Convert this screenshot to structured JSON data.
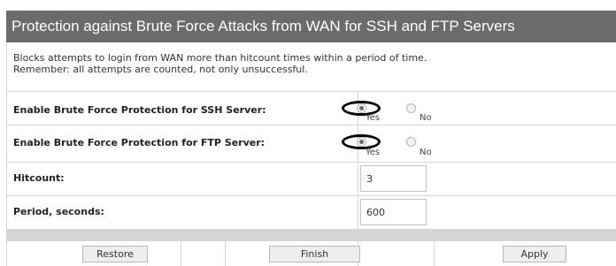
{
  "header": {
    "title": "Protection against Brute Force Attacks from WAN for SSH and FTP Servers"
  },
  "description": {
    "line1": "Blocks attempts to login from WAN more than hitcount times within a period of time.",
    "line2": "Remember: all attempts are counted, not only unsuccessful."
  },
  "ssh": {
    "label": "Enable Brute Force Protection for SSH Server:",
    "yes": "Yes",
    "no": "No",
    "selected": "Yes"
  },
  "ftp": {
    "label": "Enable Brute Force Protection for FTP Server:",
    "yes": "Yes",
    "no": "No",
    "selected": "Yes"
  },
  "hitcount": {
    "label": "Hitcount:",
    "value": "3"
  },
  "period": {
    "label": "Period, seconds:",
    "value": "600"
  },
  "buttons": {
    "restore": "Restore",
    "finish": "Finish",
    "apply": "Apply"
  }
}
